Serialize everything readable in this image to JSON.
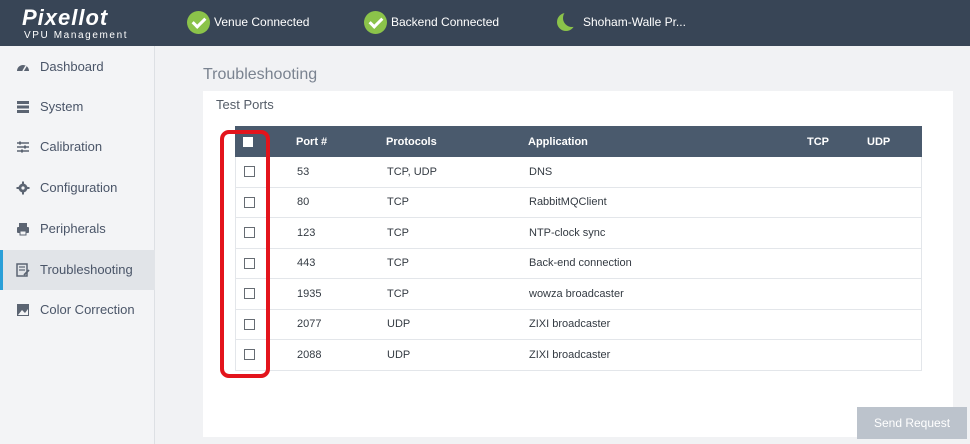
{
  "brand": {
    "name": "Pixellot",
    "subtitle": "VPU Management"
  },
  "status_bar": [
    {
      "label": "Venue Connected",
      "icon": "check-circle-icon",
      "color": "#8bc34a"
    },
    {
      "label": "Backend Connected",
      "icon": "check-circle-icon",
      "color": "#8bc34a"
    },
    {
      "label": "Shoham-Walle Pr...",
      "icon": "moon-icon",
      "color": "#8bc34a"
    }
  ],
  "sidebar": {
    "items": [
      {
        "label": "Dashboard",
        "icon": "dashboard-icon"
      },
      {
        "label": "System",
        "icon": "server-icon"
      },
      {
        "label": "Calibration",
        "icon": "sliders-icon"
      },
      {
        "label": "Configuration",
        "icon": "gear-icon"
      },
      {
        "label": "Peripherals",
        "icon": "printer-icon"
      },
      {
        "label": "Troubleshooting",
        "icon": "document-edit-icon",
        "active": true
      },
      {
        "label": "Color Correction",
        "icon": "image-icon"
      }
    ]
  },
  "page": {
    "title": "Troubleshooting"
  },
  "test_ports": {
    "title": "Test Ports",
    "columns": [
      "Port #",
      "Protocols",
      "Application",
      "TCP",
      "UDP"
    ],
    "rows": [
      {
        "port": "53",
        "protocols": "TCP, UDP",
        "application": "DNS",
        "tcp": "",
        "udp": ""
      },
      {
        "port": "80",
        "protocols": "TCP",
        "application": "RabbitMQClient",
        "tcp": "",
        "udp": ""
      },
      {
        "port": "123",
        "protocols": "TCP",
        "application": "NTP-clock sync",
        "tcp": "",
        "udp": ""
      },
      {
        "port": "443",
        "protocols": "TCP",
        "application": "Back-end connection",
        "tcp": "",
        "udp": ""
      },
      {
        "port": "1935",
        "protocols": "TCP",
        "application": "wowza broadcaster",
        "tcp": "",
        "udp": ""
      },
      {
        "port": "2077",
        "protocols": "UDP",
        "application": "ZIXI broadcaster",
        "tcp": "",
        "udp": ""
      },
      {
        "port": "2088",
        "protocols": "UDP",
        "application": "ZIXI broadcaster",
        "tcp": "",
        "udp": ""
      }
    ]
  },
  "actions": {
    "send_request": "Send Request"
  },
  "colors": {
    "topbar": "#384556",
    "accent": "#2a9fd8",
    "highlight": "#e3141c",
    "status_ok": "#8bc34a"
  }
}
